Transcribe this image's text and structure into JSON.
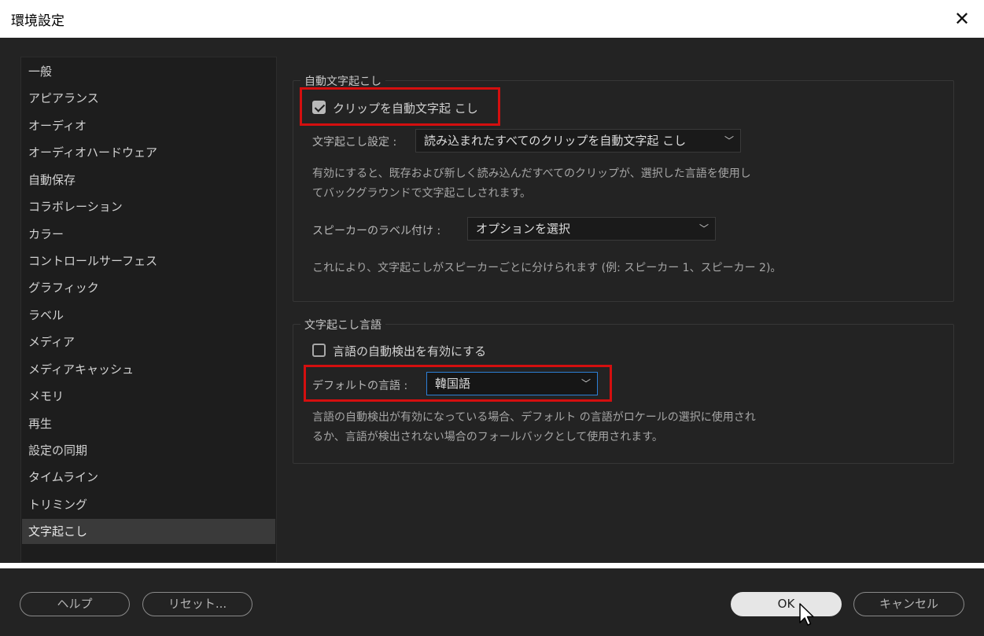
{
  "window": {
    "title": "環境設定",
    "close_icon": "close-icon"
  },
  "sidebar": {
    "items": [
      {
        "label": "一般"
      },
      {
        "label": "アピアランス"
      },
      {
        "label": "オーディオ"
      },
      {
        "label": "オーディオハードウェア"
      },
      {
        "label": "自動保存"
      },
      {
        "label": "コラボレーション"
      },
      {
        "label": "カラー"
      },
      {
        "label": "コントロールサーフェス"
      },
      {
        "label": "グラフィック"
      },
      {
        "label": "ラベル"
      },
      {
        "label": "メディア"
      },
      {
        "label": "メディアキャッシュ"
      },
      {
        "label": "メモリ"
      },
      {
        "label": "再生"
      },
      {
        "label": "設定の同期"
      },
      {
        "label": "タイムライン"
      },
      {
        "label": "トリミング"
      },
      {
        "label": "文字起こし"
      }
    ],
    "selected": "文字起こし"
  },
  "auto_transcription": {
    "group_label": "自動文字起こし",
    "checkbox_label": "クリップを自動文字起 こし",
    "checkbox_checked": true,
    "setting_label": "文字起こし設定 :",
    "setting_value": "読み込まれたすべてのクリップを自動文字起 こし",
    "description_line1": "有効にすると、既存および新しく読み込んだすべてのクリップが、選択した言語を使用し",
    "description_line2": "てバックグラウンドで文字起こしされます。",
    "speaker_label": "スピーカーのラベル付け :",
    "speaker_value": "オプションを選択",
    "speaker_description": "これにより、文字起こしがスピーカーごとに分けられます (例: スピーカー 1、スピーカー 2)。"
  },
  "language": {
    "group_label": "文字起こし言語",
    "auto_detect_label": "言語の自動検出を有効にする",
    "auto_detect_checked": false,
    "default_label": "デフォルトの言語 :",
    "default_value": "韓国語",
    "description_line1": "言語の自動検出が有効になっている場合、デフォルト の言語がロケールの選択に使用され",
    "description_line2": "るか、言語が検出されない場合のフォールバックとして使用されます。"
  },
  "footer": {
    "help": "ヘルプ",
    "reset": "リセット...",
    "ok": "OK",
    "cancel": "キャンセル"
  },
  "colors": {
    "highlight": "#d40f0f",
    "focus_border": "#2c7fd6",
    "background": "#232323"
  }
}
